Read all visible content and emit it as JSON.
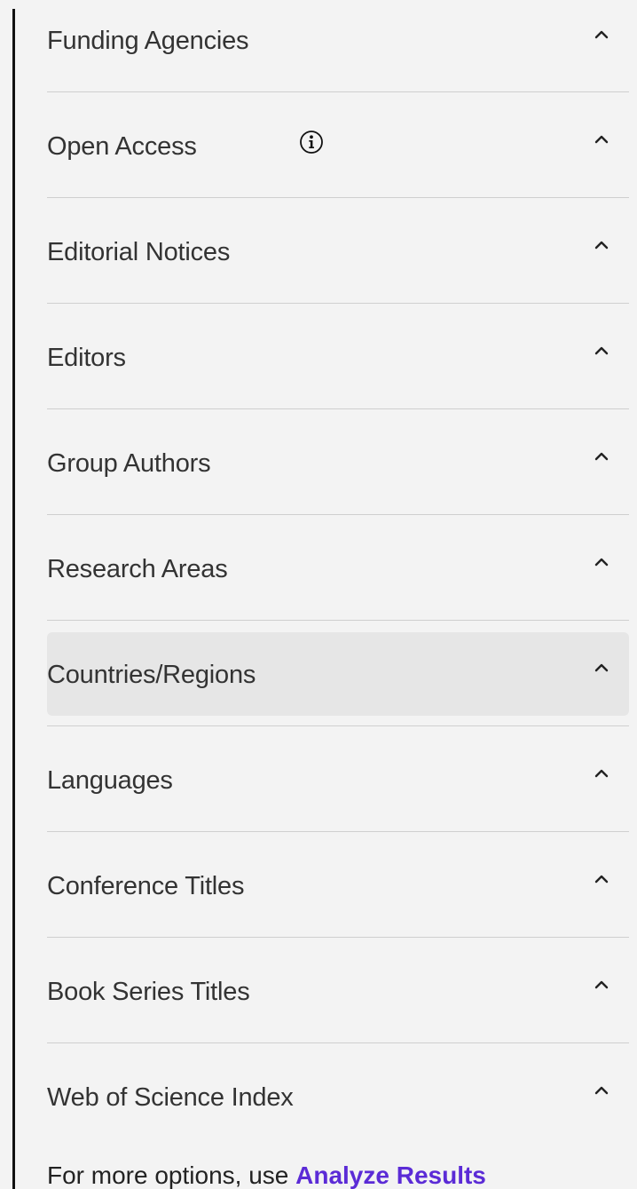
{
  "filters": [
    {
      "label": "Funding Agencies",
      "has_info": false,
      "state": "expanded"
    },
    {
      "label": "Open Access",
      "has_info": true,
      "state": "expanded"
    },
    {
      "label": "Editorial Notices",
      "has_info": false,
      "state": "expanded"
    },
    {
      "label": "Editors",
      "has_info": false,
      "state": "expanded"
    },
    {
      "label": "Group Authors",
      "has_info": false,
      "state": "expanded"
    },
    {
      "label": "Research Areas",
      "has_info": false,
      "state": "expanded"
    },
    {
      "label": "Countries/Regions",
      "has_info": false,
      "state": "expanded",
      "hovered": true
    },
    {
      "label": "Languages",
      "has_info": false,
      "state": "expanded"
    },
    {
      "label": "Conference Titles",
      "has_info": false,
      "state": "expanded"
    },
    {
      "label": "Book Series Titles",
      "has_info": false,
      "state": "expanded"
    },
    {
      "label": "Web of Science Index",
      "has_info": false,
      "state": "expanded"
    }
  ],
  "icons": {
    "toggle": "chevron-up-icon",
    "info": "info-circle-icon"
  },
  "footer": {
    "prefix": "For more options, use ",
    "link_text": "Analyze Results"
  },
  "colors": {
    "background": "#f3f3f3",
    "hover_background": "#e6e6e6",
    "divider": "#cfcfcf",
    "text": "#333333",
    "link": "#5b2bd6"
  }
}
